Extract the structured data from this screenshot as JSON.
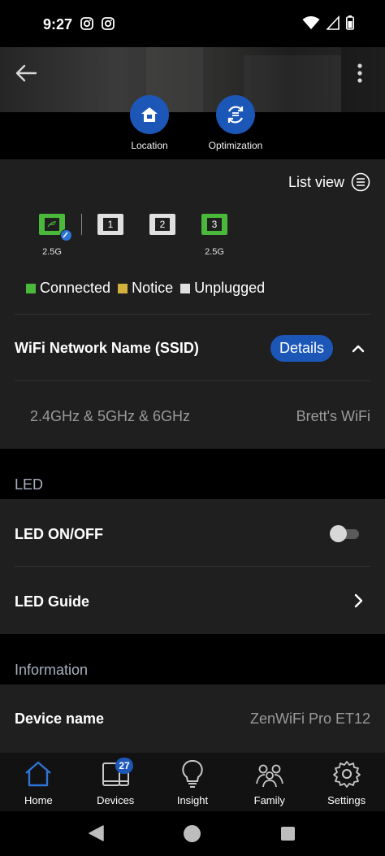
{
  "status_bar": {
    "time": "9:27",
    "left_icons": [
      "instagram-icon",
      "instagram-icon"
    ],
    "right_icons": [
      "wifi-icon",
      "cellular-signal-icon",
      "battery-icon"
    ]
  },
  "header": {
    "back_icon": "arrow-left-icon",
    "more_icon": "more-vertical-icon"
  },
  "actions": [
    {
      "label": "Location",
      "icon": "house-icon"
    },
    {
      "label": "Optimization",
      "icon": "optimization-icon"
    }
  ],
  "ports": {
    "list_view_label": "List view",
    "items": [
      {
        "label": "",
        "status": "connected",
        "speed": "2.5G",
        "type": "wan"
      },
      {
        "label": "1",
        "status": "unplugged",
        "speed": ""
      },
      {
        "label": "2",
        "status": "unplugged",
        "speed": ""
      },
      {
        "label": "3",
        "status": "connected",
        "speed": "2.5G"
      }
    ],
    "legend": [
      {
        "label": "Connected",
        "color": "#4ab83a"
      },
      {
        "label": "Notice",
        "color": "#d4b13c"
      },
      {
        "label": "Unplugged",
        "color": "#e0e0e0"
      }
    ]
  },
  "wifi": {
    "title": "WiFi Network Name (SSID)",
    "details_label": "Details",
    "bands": "2.4GHz & 5GHz & 6GHz",
    "ssid": "Brett's WiFi"
  },
  "led": {
    "section_title": "LED",
    "onoff_label": "LED ON/OFF",
    "onoff_value": false,
    "guide_label": "LED Guide"
  },
  "information": {
    "section_title": "Information",
    "device_name_label": "Device name",
    "device_name_value": "ZenWiFi Pro ET12"
  },
  "tabs": [
    {
      "label": "Home",
      "icon": "home-icon",
      "active": true
    },
    {
      "label": "Devices",
      "icon": "devices-icon",
      "badge": "27"
    },
    {
      "label": "Insight",
      "icon": "lightbulb-icon"
    },
    {
      "label": "Family",
      "icon": "family-icon"
    },
    {
      "label": "Settings",
      "icon": "gear-icon"
    }
  ],
  "colors": {
    "accent": "#1c57b8",
    "active_tab": "#2e74d6",
    "panel": "#1f1f1f"
  }
}
